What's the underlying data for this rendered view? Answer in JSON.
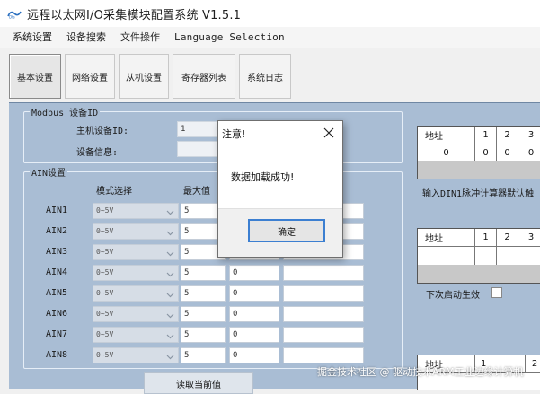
{
  "window": {
    "title": "远程以太网I/O采集模块配置系统 V1.5.1",
    "icon": "app-logo-icon"
  },
  "menu": [
    {
      "label": "系统设置"
    },
    {
      "label": "设备搜索"
    },
    {
      "label": "文件操作"
    },
    {
      "label": "Language Selection"
    }
  ],
  "tabs": [
    {
      "label": "基本设置",
      "active": true
    },
    {
      "label": "网络设置"
    },
    {
      "label": "从机设置"
    },
    {
      "label": "寄存器列表"
    },
    {
      "label": "系统日志"
    }
  ],
  "modbus": {
    "group_title": "Modbus 设备ID",
    "host_id_label": "主机设备ID:",
    "host_id_value": "1",
    "device_info_label": "设备信息:"
  },
  "ain": {
    "group_title": "AIN设置",
    "col_mode": "模式选择",
    "col_max": "最大值",
    "rows": [
      {
        "name": "AIN1",
        "mode": "0~5V",
        "max": "5",
        "min": ""
      },
      {
        "name": "AIN2",
        "mode": "0~5V",
        "max": "5",
        "min": ""
      },
      {
        "name": "AIN3",
        "mode": "0~5V",
        "max": "5",
        "min": ""
      },
      {
        "name": "AIN4",
        "mode": "0~5V",
        "max": "5",
        "min": "0"
      },
      {
        "name": "AIN5",
        "mode": "0~5V",
        "max": "5",
        "min": "0"
      },
      {
        "name": "AIN6",
        "mode": "0~5V",
        "max": "5",
        "min": "0"
      },
      {
        "name": "AIN7",
        "mode": "0~5V",
        "max": "5",
        "min": "0"
      },
      {
        "name": "AIN8",
        "mode": "0~5V",
        "max": "5",
        "min": "0"
      }
    ]
  },
  "read_button": "读取当前值",
  "right": {
    "table1": {
      "headers": [
        "地址",
        "1",
        "2",
        "3"
      ],
      "values": [
        "0",
        "0",
        "0",
        "0"
      ]
    },
    "hint1": "输入DIN1脉冲计算器默认触",
    "table2": {
      "headers": [
        "地址",
        "1",
        "2",
        "3"
      ]
    },
    "next_boot_label": "下次启动生效",
    "table3": {
      "headers": [
        "地址",
        "1",
        "2"
      ]
    }
  },
  "dialog": {
    "title": "注意!",
    "message": "数据加载成功!",
    "ok": "确定"
  },
  "watermark": "掘金技术社区 @ 驱动技术ARM工业边缘计算机",
  "colors": {
    "panel_bg": "#a9bdd4",
    "dialog_accent": "#3c7fd1"
  }
}
